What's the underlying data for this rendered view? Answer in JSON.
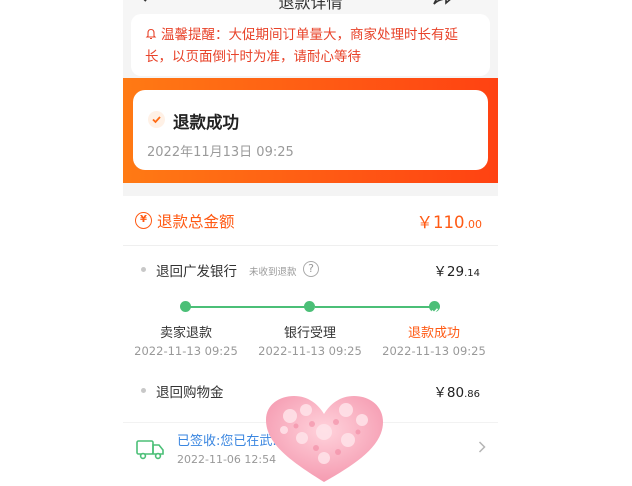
{
  "header": {
    "title": "退款详情"
  },
  "notice": {
    "text": "温馨提醒：大促期间订单量大，商家处理时长有延长，以页面倒计时为准，请耐心等待"
  },
  "status": {
    "title": "退款成功",
    "time": "2022年11月13日 09:25"
  },
  "total": {
    "icon": "yen-icon",
    "label": "退款总金额",
    "amount_main": "￥110",
    "amount_cents": ".00"
  },
  "bank": {
    "label": "退回广发银行",
    "sub": "未收到退款",
    "help": "?",
    "amount_main": "￥29",
    "amount_cents": ".14"
  },
  "progress": {
    "steps": [
      {
        "label": "卖家退款",
        "time": "2022-11-13 09:25"
      },
      {
        "label": "银行受理",
        "time": "2022-11-13 09:25"
      },
      {
        "label": "退款成功",
        "time": "2022-11-13 09:25"
      }
    ]
  },
  "shopping_credit": {
    "label": "退回购物金",
    "amount_main": "￥80",
    "amount_cents": ".86"
  },
  "logistics": {
    "text": "已签收:您已在武…",
    "time": "2022-11-06 12:54"
  },
  "colors": {
    "accent": "#ff5a14",
    "success": "#4bbf77",
    "link": "#3a86e0",
    "notice": "#e8432a"
  }
}
